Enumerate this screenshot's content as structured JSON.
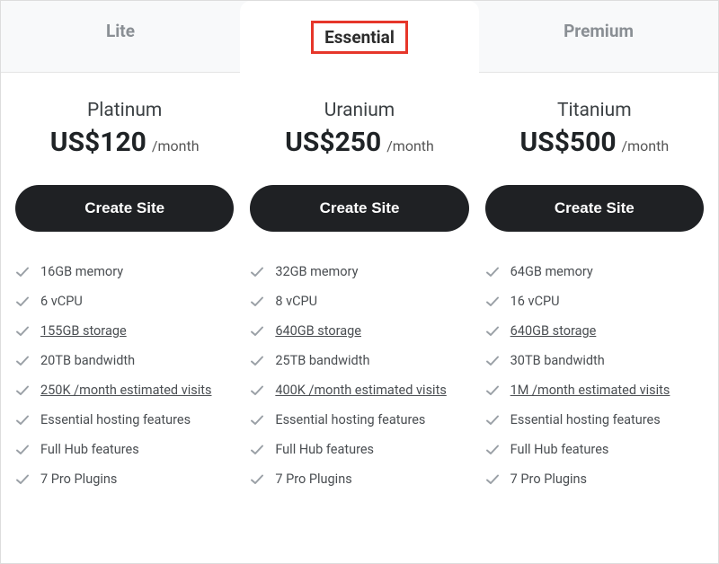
{
  "tabs": [
    {
      "label": "Lite",
      "active": false
    },
    {
      "label": "Essential",
      "active": true
    },
    {
      "label": "Premium",
      "active": false
    }
  ],
  "cta_label": "Create Site",
  "plans": [
    {
      "name": "Platinum",
      "price": "US$120",
      "period": "/month",
      "features": [
        {
          "text": "16GB memory",
          "underline": false
        },
        {
          "text": "6 vCPU",
          "underline": false
        },
        {
          "text": "155GB storage",
          "underline": true
        },
        {
          "text": "20TB bandwidth",
          "underline": false
        },
        {
          "text": "250K /month estimated visits",
          "underline": true
        },
        {
          "text": "Essential hosting features",
          "underline": false
        },
        {
          "text": "Full Hub features",
          "underline": false
        },
        {
          "text": "7 Pro Plugins",
          "underline": false
        }
      ]
    },
    {
      "name": "Uranium",
      "price": "US$250",
      "period": "/month",
      "features": [
        {
          "text": "32GB memory",
          "underline": false
        },
        {
          "text": "8 vCPU",
          "underline": false
        },
        {
          "text": "640GB storage",
          "underline": true
        },
        {
          "text": "25TB bandwidth",
          "underline": false
        },
        {
          "text": "400K /month estimated visits",
          "underline": true
        },
        {
          "text": "Essential hosting features",
          "underline": false
        },
        {
          "text": "Full Hub features",
          "underline": false
        },
        {
          "text": "7 Pro Plugins",
          "underline": false
        }
      ]
    },
    {
      "name": "Titanium",
      "price": "US$500",
      "period": "/month",
      "features": [
        {
          "text": "64GB memory",
          "underline": false
        },
        {
          "text": "16 vCPU",
          "underline": false
        },
        {
          "text": "640GB storage",
          "underline": true
        },
        {
          "text": "30TB bandwidth",
          "underline": false
        },
        {
          "text": "1M /month estimated visits",
          "underline": true
        },
        {
          "text": "Essential hosting features",
          "underline": false
        },
        {
          "text": "Full Hub features",
          "underline": false
        },
        {
          "text": "7 Pro Plugins",
          "underline": false
        }
      ]
    }
  ]
}
